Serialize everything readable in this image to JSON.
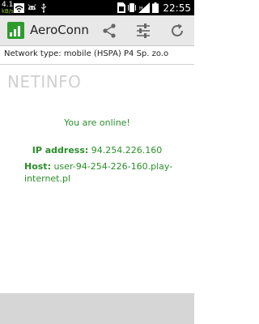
{
  "status_bar": {
    "network_top": "4.1",
    "network_bottom": "kB/s",
    "time": "22:55"
  },
  "action_bar": {
    "app_title": "AeroConn",
    "share_icon": "share-icon",
    "settings_icon": "sliders-icon",
    "refresh_icon": "refresh-icon"
  },
  "subtitle": "Network type: mobile (HSPA) P4 Sp. zo.o",
  "section_title": "NETINFO",
  "status_message": "You are online!",
  "ip": {
    "label": "IP address:",
    "value": "94.254.226.160"
  },
  "host": {
    "label": "Host:",
    "value": "user-94-254-226-160.play-internet.pl"
  },
  "colors": {
    "accent_green": "#2a8f2a",
    "app_icon_green": "#2e9b2e"
  }
}
